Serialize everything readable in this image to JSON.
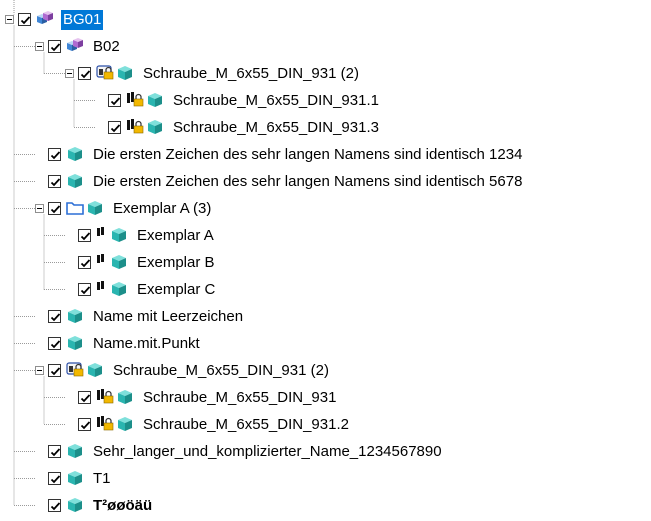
{
  "tree": {
    "nodes": [
      {
        "label": "BG01",
        "depth": 0,
        "expanded": true,
        "checked": true,
        "selected": true,
        "icons": [
          "assembly-icon"
        ]
      },
      {
        "label": "B02",
        "depth": 1,
        "expanded": true,
        "checked": true,
        "icons": [
          "assembly-icon"
        ]
      },
      {
        "label": "Schraube_M_6x55_DIN_931 (2)",
        "depth": 2,
        "expanded": true,
        "checked": true,
        "icons": [
          "locked-group-icon",
          "part-icon"
        ]
      },
      {
        "label": "Schraube_M_6x55_DIN_931.1",
        "depth": 3,
        "checked": true,
        "icons": [
          "locked-instance-icon",
          "part-icon"
        ]
      },
      {
        "label": "Schraube_M_6x55_DIN_931.3",
        "depth": 3,
        "checked": true,
        "icons": [
          "locked-instance-icon",
          "part-icon"
        ]
      },
      {
        "label": "Die ersten Zeichen des sehr langen Namens sind identisch 1234",
        "depth": 1,
        "checked": true,
        "icons": [
          "part-icon"
        ]
      },
      {
        "label": "Die ersten Zeichen des sehr langen Namens sind identisch 5678",
        "depth": 1,
        "checked": true,
        "icons": [
          "part-icon"
        ]
      },
      {
        "label": "Exemplar A (3)",
        "depth": 1,
        "expanded": true,
        "checked": true,
        "icons": [
          "folder-icon",
          "part-icon"
        ]
      },
      {
        "label": "Exemplar A",
        "depth": 2,
        "checked": true,
        "icons": [
          "instance-icon",
          "part-icon"
        ]
      },
      {
        "label": "Exemplar B",
        "depth": 2,
        "checked": true,
        "icons": [
          "instance-icon",
          "part-icon"
        ]
      },
      {
        "label": "Exemplar C",
        "depth": 2,
        "checked": true,
        "icons": [
          "instance-icon",
          "part-icon"
        ]
      },
      {
        "label": "Name mit Leerzeichen",
        "depth": 1,
        "checked": true,
        "icons": [
          "part-icon"
        ]
      },
      {
        "label": "Name.mit.Punkt",
        "depth": 1,
        "checked": true,
        "icons": [
          "part-icon"
        ]
      },
      {
        "label": "Schraube_M_6x55_DIN_931 (2)",
        "depth": 1,
        "expanded": true,
        "checked": true,
        "icons": [
          "locked-group-icon",
          "part-icon"
        ]
      },
      {
        "label": "Schraube_M_6x55_DIN_931",
        "depth": 2,
        "checked": true,
        "icons": [
          "locked-instance-icon",
          "part-icon"
        ]
      },
      {
        "label": "Schraube_M_6x55_DIN_931.2",
        "depth": 2,
        "checked": true,
        "icons": [
          "locked-instance-icon",
          "part-icon"
        ]
      },
      {
        "label": "Sehr_langer_und_komplizierter_Name_1234567890",
        "depth": 1,
        "checked": true,
        "icons": [
          "part-icon"
        ]
      },
      {
        "label": "T1",
        "depth": 1,
        "checked": true,
        "icons": [
          "part-icon"
        ]
      },
      {
        "label": "T²øøöäü",
        "depth": 1,
        "checked": true,
        "bold": true,
        "icons": [
          "part-icon"
        ]
      }
    ]
  },
  "colors": {
    "selection": "#0078d7",
    "part": "#2ab5b0",
    "assembly": "#3f86d6",
    "folder": "#2c6fd6",
    "lock": "#f2b800"
  }
}
